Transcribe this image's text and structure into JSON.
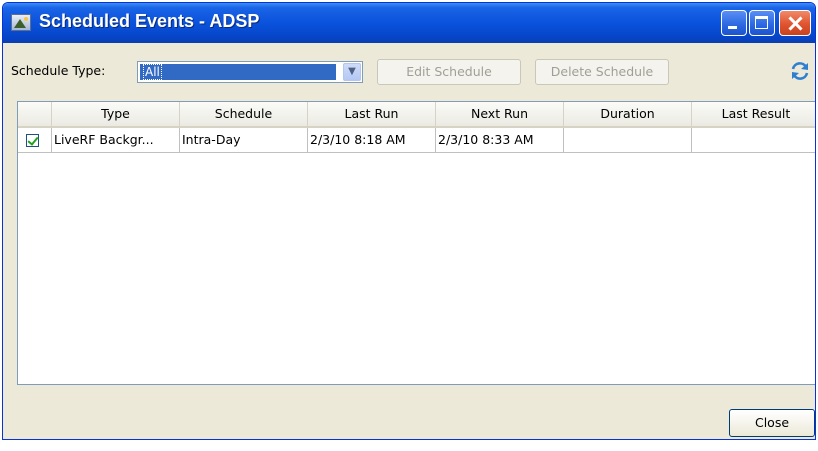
{
  "window": {
    "title": "Scheduled Events - ADSP"
  },
  "toolbar": {
    "schedule_type_label": "Schedule Type:",
    "schedule_type_value": "All",
    "edit_label": "Edit Schedule",
    "delete_label": "Delete Schedule"
  },
  "table": {
    "columns": [
      "Type",
      "Schedule",
      "Last Run",
      "Next Run",
      "Duration",
      "Last Result"
    ],
    "rows": [
      {
        "checked": true,
        "type": "LiveRF Backgr...",
        "schedule": "Intra-Day",
        "last_run": "2/3/10 8:18 AM",
        "next_run": "2/3/10 8:33 AM",
        "duration": "",
        "last_result": ""
      }
    ]
  },
  "footer": {
    "close_label": "Close"
  },
  "icons": {
    "app": "window-app-icon",
    "minimize": "minimize-icon",
    "maximize": "maximize-icon",
    "close": "close-icon",
    "refresh": "refresh-icon",
    "dropdown": "chevron-down-icon",
    "check": "checkbox-checked-icon"
  },
  "colors": {
    "title_bar": "#0a52dc",
    "selection": "#316ac5",
    "close_button": "#e0542f",
    "check": "#21a121"
  }
}
